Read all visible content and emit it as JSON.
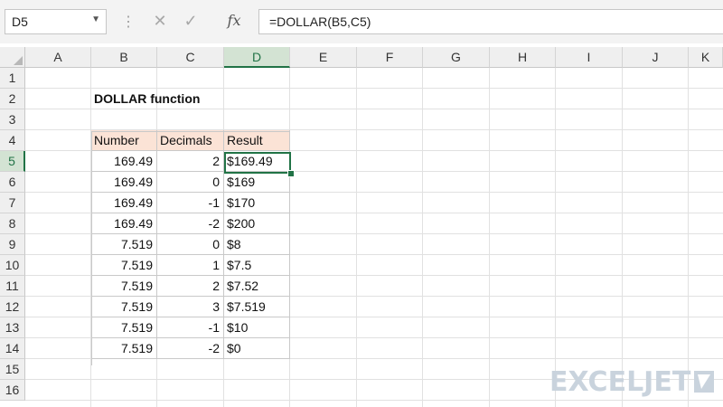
{
  "formula_bar": {
    "name_box": "D5",
    "formula": "=DOLLAR(B5,C5)",
    "fx_label": "fx"
  },
  "columns": [
    "A",
    "B",
    "C",
    "D",
    "E",
    "F",
    "G",
    "H",
    "I",
    "J",
    "K"
  ],
  "selected_column": "D",
  "rows": [
    "1",
    "2",
    "3",
    "4",
    "5",
    "6",
    "7",
    "8",
    "9",
    "10",
    "11",
    "12",
    "13",
    "14",
    "15",
    "16"
  ],
  "selected_row": "5",
  "sheet": {
    "title": "DOLLAR function",
    "table_headers": [
      "Number",
      "Decimals",
      "Result"
    ],
    "table_rows": [
      [
        "169.49",
        "2",
        "$169.49"
      ],
      [
        "169.49",
        "0",
        "$169"
      ],
      [
        "169.49",
        "-1",
        "$170"
      ],
      [
        "169.49",
        "-2",
        "$200"
      ],
      [
        "7.519",
        "0",
        "$8"
      ],
      [
        "7.519",
        "1",
        "$7.5"
      ],
      [
        "7.519",
        "2",
        "$7.52"
      ],
      [
        "7.519",
        "3",
        "$7.519"
      ],
      [
        "7.519",
        "-1",
        "$10"
      ],
      [
        "7.519",
        "-2",
        "$0"
      ]
    ]
  },
  "logo": "EXCELJET",
  "colors": {
    "accent": "#217346",
    "header_fill": "#fbe3d6",
    "logo": "#c9d3dd"
  }
}
